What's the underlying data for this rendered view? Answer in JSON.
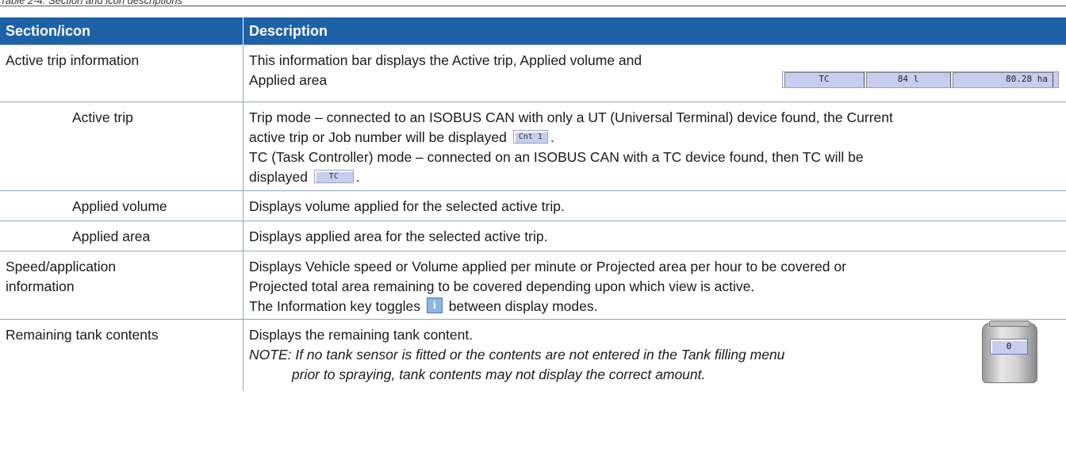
{
  "caption": "Table 2-4: Section and icon descriptions",
  "headers": {
    "section": "Section/icon",
    "description": "Description"
  },
  "rows": {
    "active_trip_info": {
      "label": "Active trip information",
      "line1": "This information bar displays the Active trip, Applied volume and",
      "line2": "Applied area",
      "status_bar": {
        "trip": "TC",
        "volume": "84 l",
        "area": "80.28 ha"
      }
    },
    "active_trip": {
      "label": "Active trip",
      "line1": "Trip mode – connected to an ISOBUS CAN with only a UT (Universal Terminal) device found, the Current",
      "line2a": "active trip or Job number will be displayed",
      "line2_icon": "Cnt  1",
      "line2b": ".",
      "line3": "TC (Task Controller) mode – connected on an ISOBUS CAN with a TC device found, then TC will be",
      "line4a": "displayed",
      "line4_icon": "TC",
      "line4b": "."
    },
    "applied_volume": {
      "label": "Applied volume",
      "text": "Displays volume applied for the selected active trip."
    },
    "applied_area": {
      "label": "Applied area",
      "text": "Displays applied area for the selected active trip."
    },
    "speed_info": {
      "label_line1": "Speed/application",
      "label_line2": "information",
      "line1": "Displays Vehicle speed or Volume applied per minute or Projected area per hour to be covered or",
      "line2": "Projected total area remaining to be covered depending upon which view is active.",
      "line3a": "The Information key toggles",
      "line3_icon": "info-icon",
      "line3_icon_glyph": "i",
      "line3b": "between display modes."
    },
    "tank": {
      "label": "Remaining tank contents",
      "line1": "Displays the remaining tank content.",
      "note_line1": "NOTE:  If no tank sensor is fitted or the contents are not entered in the Tank filling menu",
      "note_line2": "prior to spraying, tank contents may not display the correct amount.",
      "tank_value": "0"
    }
  }
}
